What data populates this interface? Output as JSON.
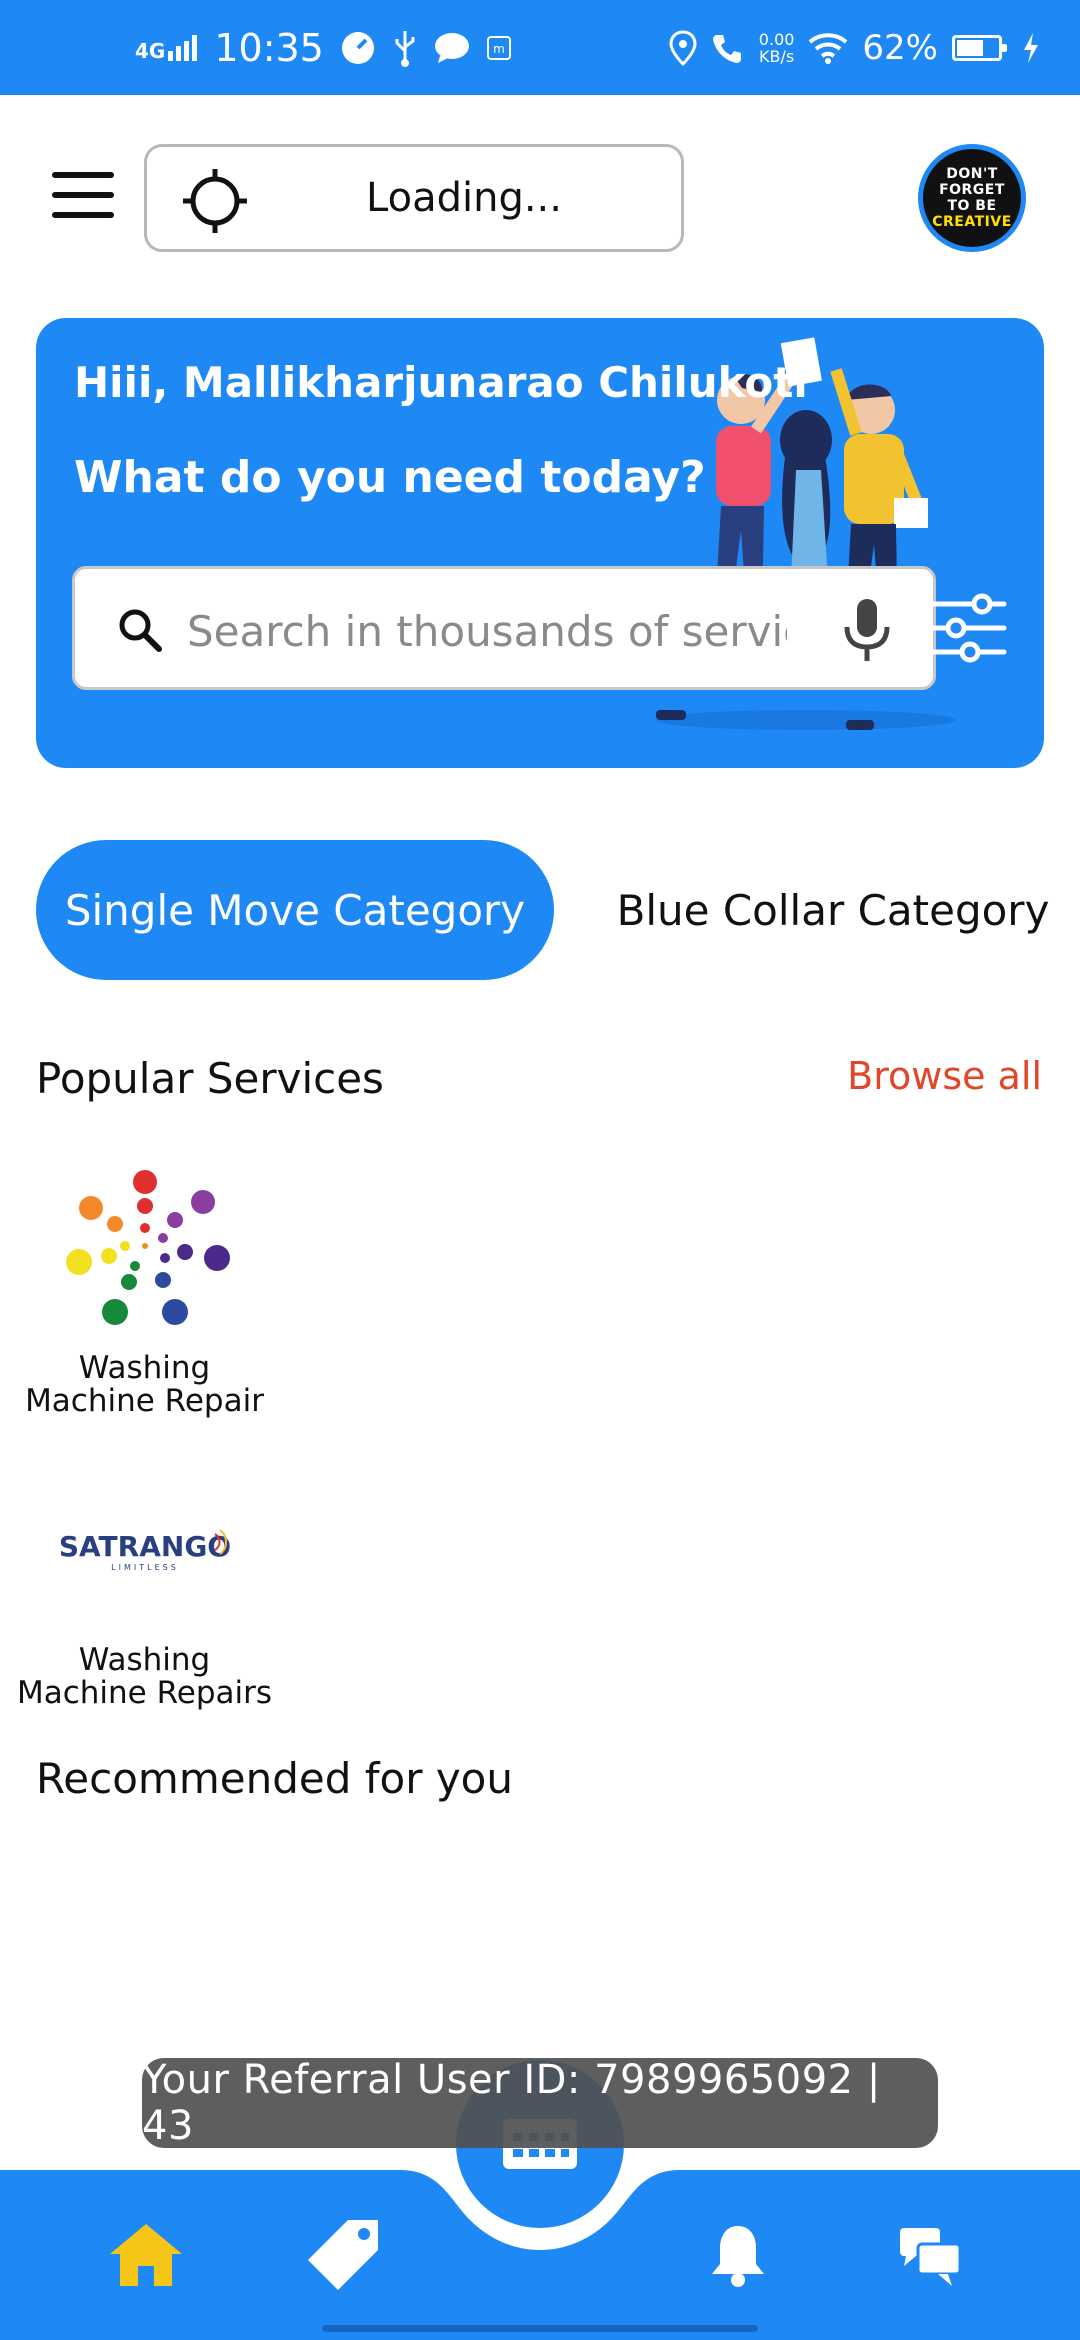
{
  "status_bar": {
    "network": "4G",
    "time": "10:35",
    "speed_value": "0.00",
    "speed_unit": "KB/s",
    "battery": "62%"
  },
  "header": {
    "location_text": "Loading...",
    "avatar_lines": [
      "DON'T",
      "FORGET",
      "TO BE",
      "CREATIVE"
    ]
  },
  "hero": {
    "greeting": "Hiii, Mallikharjunarao Chilukoti",
    "question": "What do you need today?",
    "search_placeholder": "Search in thousands of servic..."
  },
  "categories": {
    "active": "Single Move Category",
    "inactive": "Blue Collar Category"
  },
  "popular": {
    "title": "Popular Services",
    "browse_all": "Browse all",
    "items": [
      {
        "label": "Washing Machine Repair"
      },
      {
        "label": "Washing Machine Repairs",
        "logo_text": "SATRANGO",
        "logo_sub": "LIMITLESS"
      }
    ]
  },
  "recommended": {
    "title": "Recommended for you"
  },
  "toast": {
    "text": "Your Referral User ID: 7989965092 | 43"
  },
  "colors": {
    "primary": "#1e88f5",
    "accent": "#e0472a",
    "home_icon": "#f5c518"
  },
  "nav": {
    "items": [
      "home-icon",
      "tag-icon",
      "calendar-icon",
      "bell-icon",
      "chat-icon"
    ]
  }
}
